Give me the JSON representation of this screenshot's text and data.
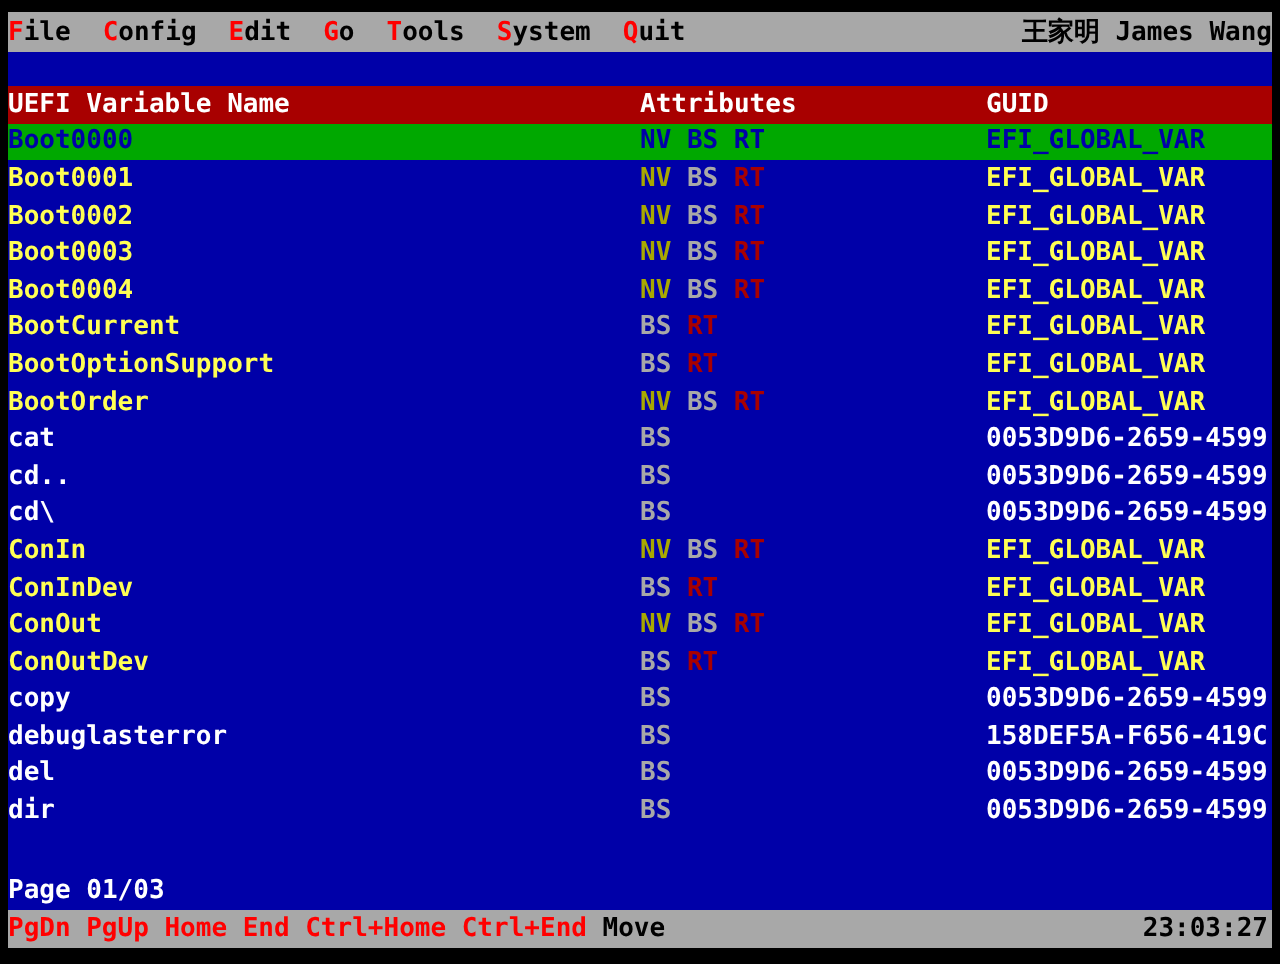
{
  "menu": [
    {
      "label": "File"
    },
    {
      "label": "Config"
    },
    {
      "label": "Edit"
    },
    {
      "label": "Go"
    },
    {
      "label": "Tools"
    },
    {
      "label": "System"
    },
    {
      "label": "Quit"
    }
  ],
  "user": "王家明 James Wang",
  "table": {
    "columns": [
      "UEFI Variable Name",
      "Attributes",
      "GUID"
    ],
    "rows": [
      {
        "name": "Boot0000",
        "kind": "global",
        "selected": true,
        "attributes": [
          {
            "text": "NV"
          },
          {
            "text": "BS"
          },
          {
            "text": "RT"
          }
        ],
        "guid": "EFI_GLOBAL_VAR"
      },
      {
        "name": "Boot0001",
        "kind": "global",
        "selected": false,
        "attributes": [
          {
            "text": "NV",
            "kind": "nv"
          },
          {
            "text": "BS",
            "kind": "bs"
          },
          {
            "text": "RT",
            "kind": "rt"
          }
        ],
        "guid": "EFI_GLOBAL_VAR"
      },
      {
        "name": "Boot0002",
        "kind": "global",
        "selected": false,
        "attributes": [
          {
            "text": "NV",
            "kind": "nv"
          },
          {
            "text": "BS",
            "kind": "bs"
          },
          {
            "text": "RT",
            "kind": "rt"
          }
        ],
        "guid": "EFI_GLOBAL_VAR"
      },
      {
        "name": "Boot0003",
        "kind": "global",
        "selected": false,
        "attributes": [
          {
            "text": "NV",
            "kind": "nv"
          },
          {
            "text": "BS",
            "kind": "bs"
          },
          {
            "text": "RT",
            "kind": "rt"
          }
        ],
        "guid": "EFI_GLOBAL_VAR"
      },
      {
        "name": "Boot0004",
        "kind": "global",
        "selected": false,
        "attributes": [
          {
            "text": "NV",
            "kind": "nv"
          },
          {
            "text": "BS",
            "kind": "bs"
          },
          {
            "text": "RT",
            "kind": "rt"
          }
        ],
        "guid": "EFI_GLOBAL_VAR"
      },
      {
        "name": "BootCurrent",
        "kind": "global",
        "selected": false,
        "attributes": [
          {
            "text": "BS",
            "kind": "bs"
          },
          {
            "text": "RT",
            "kind": "rt"
          }
        ],
        "guid": "EFI_GLOBAL_VAR"
      },
      {
        "name": "BootOptionSupport",
        "kind": "global",
        "selected": false,
        "attributes": [
          {
            "text": "BS",
            "kind": "bs"
          },
          {
            "text": "RT",
            "kind": "rt"
          }
        ],
        "guid": "EFI_GLOBAL_VAR"
      },
      {
        "name": "BootOrder",
        "kind": "global",
        "selected": false,
        "attributes": [
          {
            "text": "NV",
            "kind": "nv"
          },
          {
            "text": "BS",
            "kind": "bs"
          },
          {
            "text": "RT",
            "kind": "rt"
          }
        ],
        "guid": "EFI_GLOBAL_VAR"
      },
      {
        "name": "cat",
        "kind": "other",
        "selected": false,
        "attributes": [
          {
            "text": "BS",
            "kind": "bs"
          }
        ],
        "guid": "0053D9D6-2659-4599"
      },
      {
        "name": "cd..",
        "kind": "other",
        "selected": false,
        "attributes": [
          {
            "text": "BS",
            "kind": "bs"
          }
        ],
        "guid": "0053D9D6-2659-4599"
      },
      {
        "name": "cd\\",
        "kind": "other",
        "selected": false,
        "attributes": [
          {
            "text": "BS",
            "kind": "bs"
          }
        ],
        "guid": "0053D9D6-2659-4599"
      },
      {
        "name": "ConIn",
        "kind": "global",
        "selected": false,
        "attributes": [
          {
            "text": "NV",
            "kind": "nv"
          },
          {
            "text": "BS",
            "kind": "bs"
          },
          {
            "text": "RT",
            "kind": "rt"
          }
        ],
        "guid": "EFI_GLOBAL_VAR"
      },
      {
        "name": "ConInDev",
        "kind": "global",
        "selected": false,
        "attributes": [
          {
            "text": "BS",
            "kind": "bs"
          },
          {
            "text": "RT",
            "kind": "rt"
          }
        ],
        "guid": "EFI_GLOBAL_VAR"
      },
      {
        "name": "ConOut",
        "kind": "global",
        "selected": false,
        "attributes": [
          {
            "text": "NV",
            "kind": "nv"
          },
          {
            "text": "BS",
            "kind": "bs"
          },
          {
            "text": "RT",
            "kind": "rt"
          }
        ],
        "guid": "EFI_GLOBAL_VAR"
      },
      {
        "name": "ConOutDev",
        "kind": "global",
        "selected": false,
        "attributes": [
          {
            "text": "BS",
            "kind": "bs"
          },
          {
            "text": "RT",
            "kind": "rt"
          }
        ],
        "guid": "EFI_GLOBAL_VAR"
      },
      {
        "name": "copy",
        "kind": "other",
        "selected": false,
        "attributes": [
          {
            "text": "BS",
            "kind": "bs"
          }
        ],
        "guid": "0053D9D6-2659-4599"
      },
      {
        "name": "debuglasterror",
        "kind": "other",
        "selected": false,
        "attributes": [
          {
            "text": "BS",
            "kind": "bs"
          }
        ],
        "guid": "158DEF5A-F656-419C"
      },
      {
        "name": "del",
        "kind": "other",
        "selected": false,
        "attributes": [
          {
            "text": "BS",
            "kind": "bs"
          }
        ],
        "guid": "0053D9D6-2659-4599"
      },
      {
        "name": "dir",
        "kind": "other",
        "selected": false,
        "attributes": [
          {
            "text": "BS",
            "kind": "bs"
          }
        ],
        "guid": "0053D9D6-2659-4599"
      }
    ]
  },
  "page_indicator": "Page 01/03",
  "status_bar": {
    "hints": [
      {
        "text": "PgDn",
        "kind": "key"
      },
      {
        "text": "PgUp",
        "kind": "key"
      },
      {
        "text": "Home",
        "kind": "key"
      },
      {
        "text": "End",
        "kind": "key"
      },
      {
        "text": "Ctrl+Home",
        "kind": "key"
      },
      {
        "text": "Ctrl+End",
        "kind": "key"
      },
      {
        "text": "Move",
        "kind": "action"
      }
    ],
    "time": "23:03:27"
  }
}
